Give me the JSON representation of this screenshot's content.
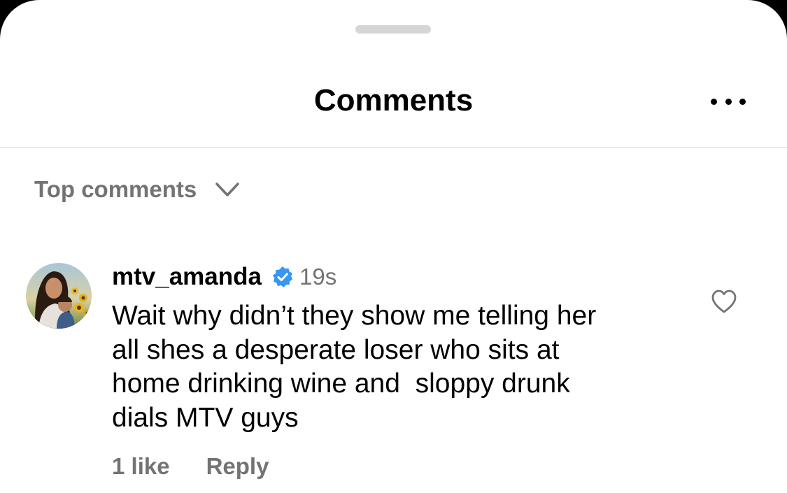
{
  "sheet": {
    "title": "Comments"
  },
  "sort": {
    "label": "Top comments"
  },
  "comment": {
    "username": "mtv_amanda",
    "verified": true,
    "time": "19s",
    "lines": [
      "Wait why didn’t they show me telling her",
      "all shes a desperate loser who sits at",
      "home drinking wine and  sloppy drunk",
      "dials MTV guys"
    ],
    "likes": "1 like",
    "reply_label": "Reply"
  },
  "colors": {
    "verified_badge": "#3897f0",
    "secondary_text": "#737373",
    "divider": "#dbdbdb",
    "grabber": "#d6d6d6"
  },
  "icons": {
    "more": "more-horizontal-icon",
    "sort": "chevron-down-icon",
    "verified": "verified-badge-icon",
    "like": "heart-outline-icon"
  }
}
